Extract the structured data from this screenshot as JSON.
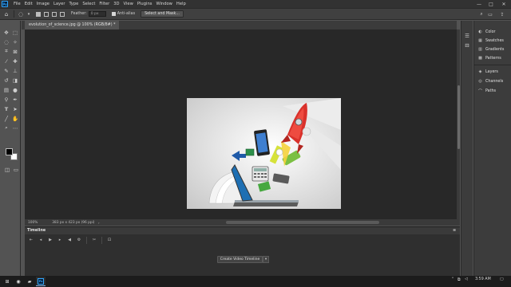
{
  "app": {
    "logo": "Ps"
  },
  "menubar": {
    "items": [
      "File",
      "Edit",
      "Image",
      "Layer",
      "Type",
      "Select",
      "Filter",
      "3D",
      "View",
      "Plugins",
      "Window",
      "Help"
    ],
    "window_controls": {
      "minimize": "—",
      "maximize": "□",
      "close": "✕"
    }
  },
  "options_bar": {
    "feather_label": "Feather:",
    "feather_value": "0 px",
    "anti_alias_label": "Anti-alias",
    "select_mask_label": "Select and Mask..."
  },
  "document": {
    "tab_title": "evolution_of_science.jpg @ 100% (RGB/8#) *"
  },
  "status_bar": {
    "zoom": "100%",
    "doc_info": "383 px x 423 px (96 ppi)"
  },
  "timeline": {
    "title": "Timeline",
    "create_button_label": "Create Video Timeline"
  },
  "right_panels": {
    "group1": [
      "Color",
      "Swatches",
      "Gradients",
      "Patterns"
    ],
    "group2": [
      "Layers",
      "Channels",
      "Paths"
    ]
  },
  "taskbar": {
    "time": "3:59 AM"
  },
  "colors": {
    "accent_blue": "#31a8ff",
    "canvas_bg": "#282828",
    "panel_bg": "#3c3c3c",
    "foreground_color": "#000000",
    "background_color": "#ffffff"
  }
}
